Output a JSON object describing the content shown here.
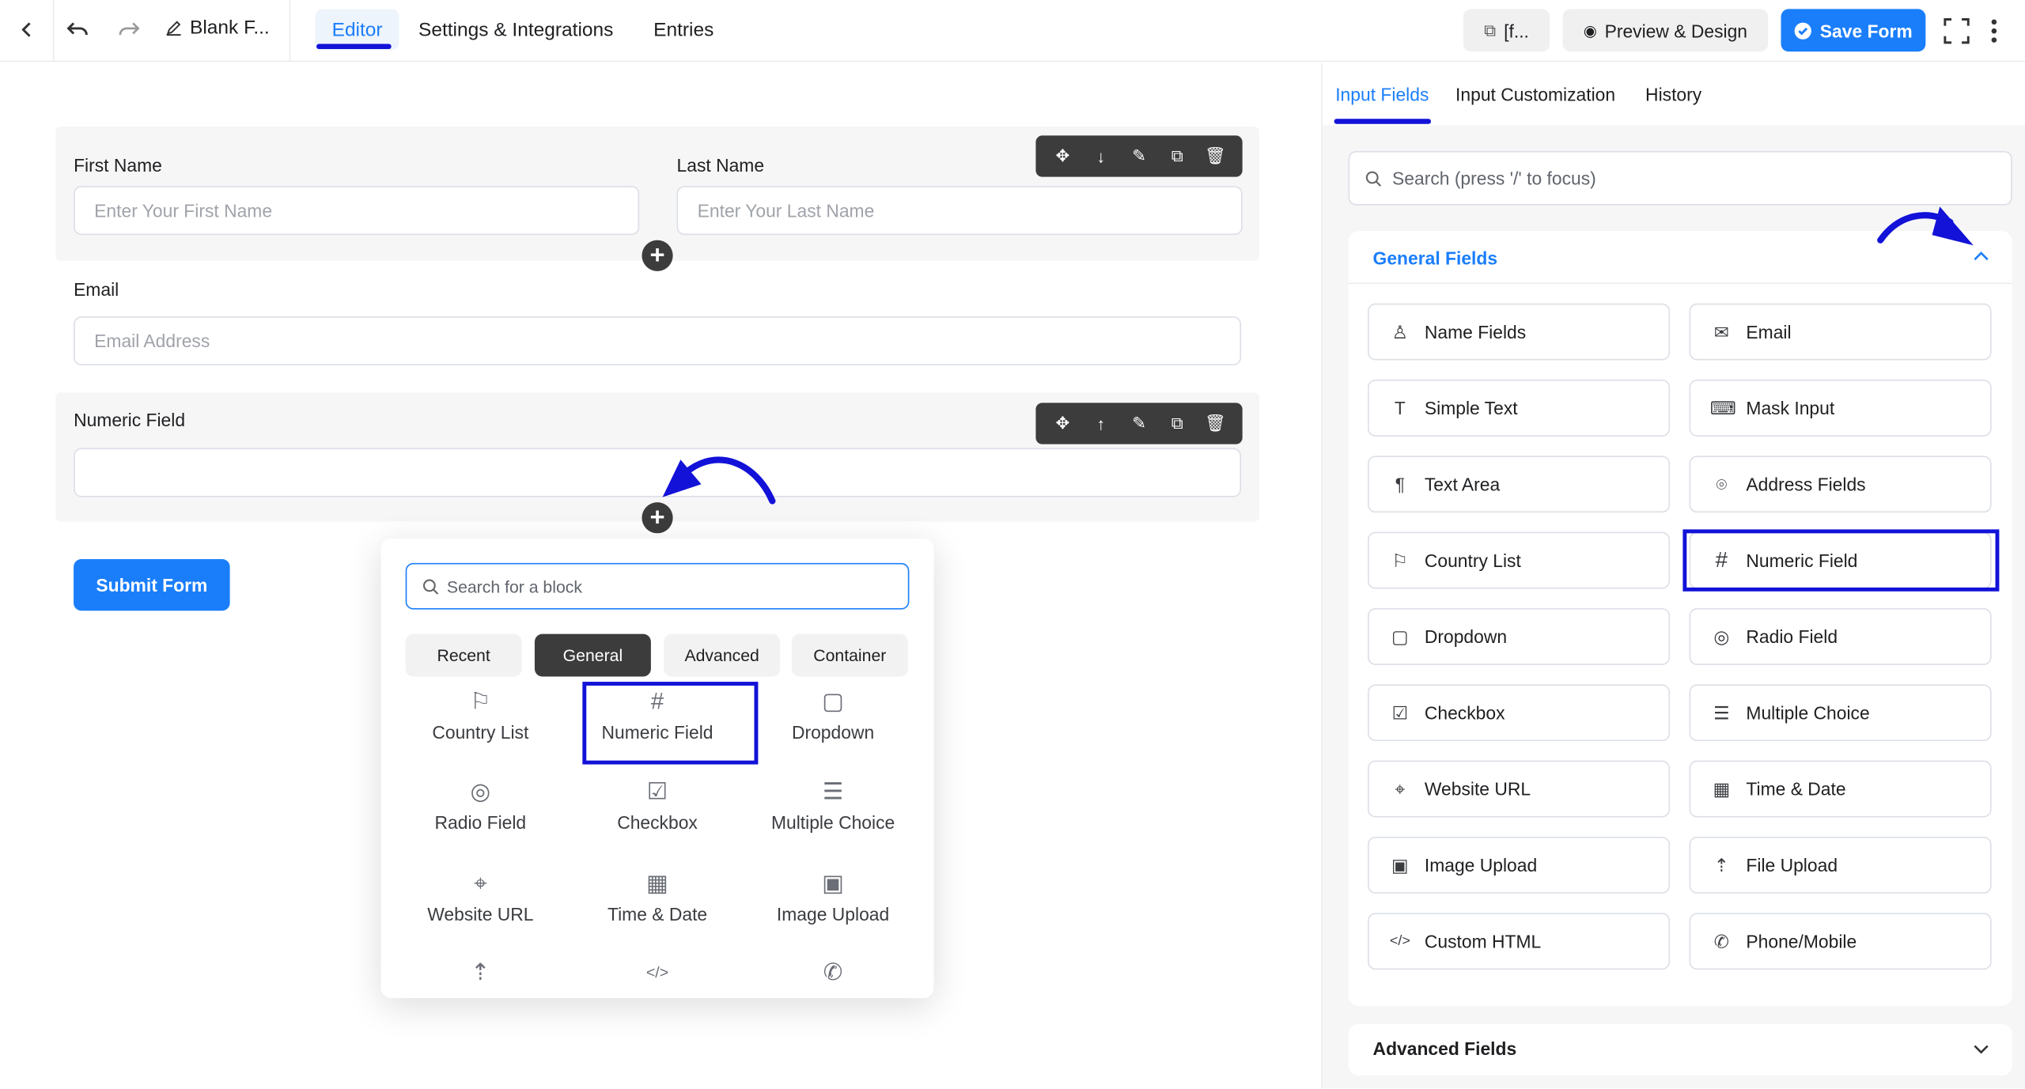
{
  "header": {
    "title": "Blank F...",
    "tabs": [
      "Editor",
      "Settings & Integrations",
      "Entries"
    ],
    "shortcode_label": "[f...",
    "preview_label": "Preview & Design",
    "save_label": "Save Form"
  },
  "form": {
    "first_name": {
      "label": "First Name",
      "placeholder": "Enter Your First Name"
    },
    "last_name": {
      "label": "Last Name",
      "placeholder": "Enter Your Last Name"
    },
    "email": {
      "label": "Email",
      "placeholder": "Email Address"
    },
    "numeric": {
      "label": "Numeric Field",
      "value": ""
    },
    "submit_label": "Submit Form"
  },
  "block_popup": {
    "search_placeholder": "Search for a block",
    "tabs": [
      "Recent",
      "General",
      "Advanced",
      "Container"
    ],
    "active_tab": "General",
    "blocks": [
      {
        "label": "Country List",
        "icon": "flag-icon"
      },
      {
        "label": "Numeric Field",
        "icon": "hash-icon"
      },
      {
        "label": "Dropdown",
        "icon": "dropdown-icon"
      },
      {
        "label": "Radio Field",
        "icon": "radio-icon"
      },
      {
        "label": "Checkbox",
        "icon": "checkbox-icon"
      },
      {
        "label": "Multiple Choice",
        "icon": "list-icon"
      },
      {
        "label": "Website URL",
        "icon": "link-icon"
      },
      {
        "label": "Time & Date",
        "icon": "calendar-icon"
      },
      {
        "label": "Image Upload",
        "icon": "image-icon"
      }
    ]
  },
  "sidebar": {
    "tabs": [
      "Input Fields",
      "Input Customization",
      "History"
    ],
    "search_placeholder": "Search (press '/' to focus)",
    "general_title": "General Fields",
    "fields": [
      {
        "label": "Name Fields",
        "icon": "user-icon"
      },
      {
        "label": "Email",
        "icon": "envelope-icon"
      },
      {
        "label": "Simple Text",
        "icon": "text-icon"
      },
      {
        "label": "Mask Input",
        "icon": "keyboard-icon"
      },
      {
        "label": "Text Area",
        "icon": "paragraph-icon"
      },
      {
        "label": "Address Fields",
        "icon": "location-icon"
      },
      {
        "label": "Country List",
        "icon": "flag-icon"
      },
      {
        "label": "Numeric Field",
        "icon": "hash-icon"
      },
      {
        "label": "Dropdown",
        "icon": "dropdown-icon"
      },
      {
        "label": "Radio Field",
        "icon": "radio-icon"
      },
      {
        "label": "Checkbox",
        "icon": "checkbox-icon"
      },
      {
        "label": "Multiple Choice",
        "icon": "list-icon"
      },
      {
        "label": "Website URL",
        "icon": "link-icon"
      },
      {
        "label": "Time & Date",
        "icon": "calendar-icon"
      },
      {
        "label": "Image Upload",
        "icon": "image-icon"
      },
      {
        "label": "File Upload",
        "icon": "upload-icon"
      },
      {
        "label": "Custom HTML",
        "icon": "code-icon"
      },
      {
        "label": "Phone/Mobile",
        "icon": "phone-icon"
      }
    ],
    "advanced_title": "Advanced Fields"
  },
  "colors": {
    "accent": "#1a7efb",
    "annotation": "#1212d8",
    "dark": "#3c3c3c"
  }
}
